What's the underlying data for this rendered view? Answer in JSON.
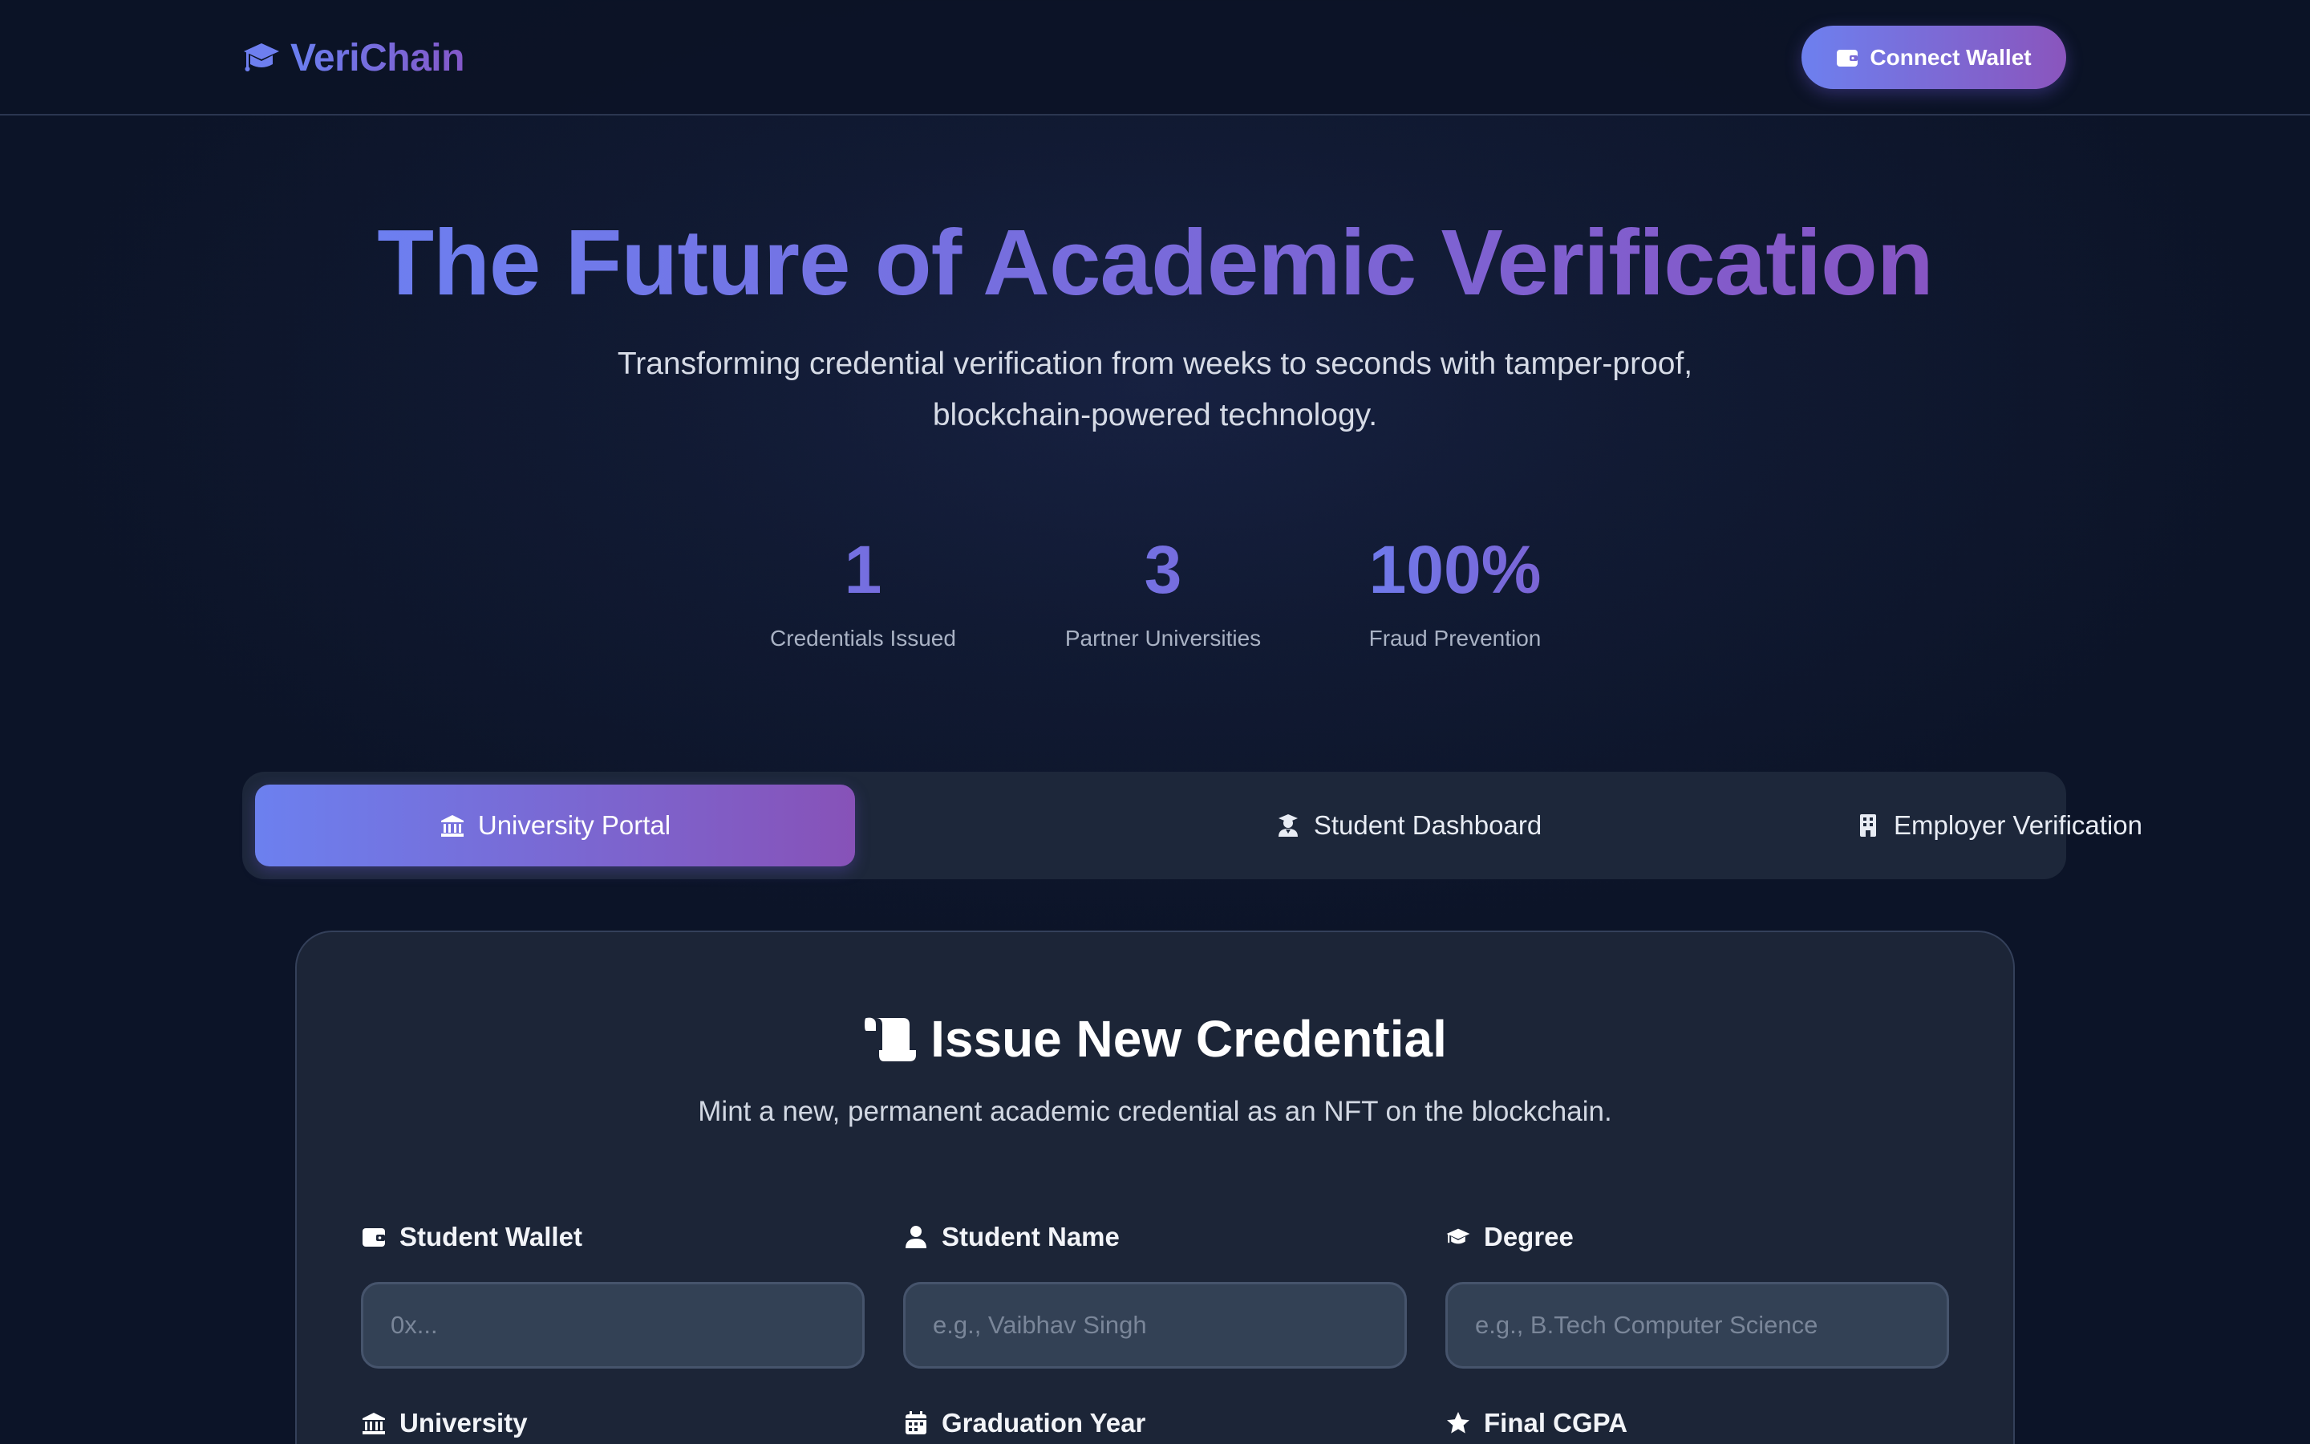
{
  "nav": {
    "brand": "VeriChain",
    "connect_label": "Connect Wallet"
  },
  "hero": {
    "title": "The Future of Academic Verification",
    "subtitle": "Transforming credential verification from weeks to seconds with tamper-proof, blockchain-powered technology."
  },
  "stats": [
    {
      "value": "1",
      "label": "Credentials Issued"
    },
    {
      "value": "3",
      "label": "Partner Universities"
    },
    {
      "value": "100%",
      "label": "Fraud Prevention"
    }
  ],
  "tabs": [
    {
      "label": "University Portal",
      "icon": "university-icon",
      "active": true
    },
    {
      "label": "Student Dashboard",
      "icon": "student-icon",
      "active": false
    },
    {
      "label": "Employer Verification",
      "icon": "building-icon",
      "active": false
    }
  ],
  "form": {
    "title": "Issue New Credential",
    "subtitle": "Mint a new, permanent academic credential as an NFT on the blockchain.",
    "fields": [
      {
        "label": "Student Wallet",
        "placeholder": "0x...",
        "value": "",
        "icon": "wallet-icon"
      },
      {
        "label": "Student Name",
        "placeholder": "e.g., Vaibhav Singh",
        "value": "",
        "icon": "user-icon"
      },
      {
        "label": "Degree",
        "placeholder": "e.g., B.Tech Computer Science",
        "value": "",
        "icon": "graduation-cap-icon"
      },
      {
        "label": "University",
        "placeholder": "",
        "value": "",
        "icon": "university-icon"
      },
      {
        "label": "Graduation Year",
        "placeholder": "",
        "value": "",
        "icon": "calendar-icon"
      },
      {
        "label": "Final CGPA",
        "placeholder": "",
        "value": "",
        "icon": "star-icon"
      }
    ]
  },
  "colors": {
    "accent_start": "#6d80ef",
    "accent_end": "#8a55bd",
    "background": "#0f172a",
    "card": "#1c2537"
  }
}
